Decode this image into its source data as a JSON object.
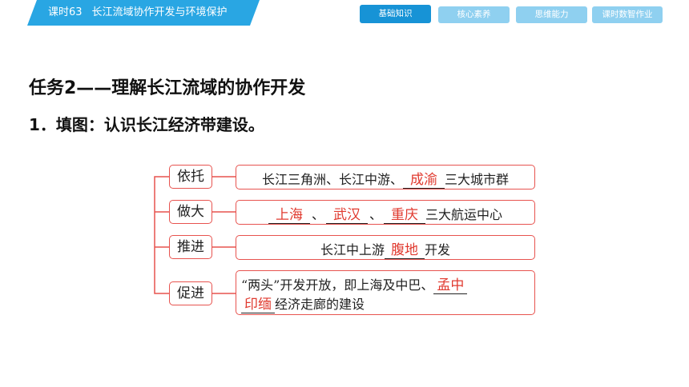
{
  "header": {
    "lesson_number": "课时63",
    "lesson_title": "长江流域协作开发与环境保护",
    "tabs": [
      "基础知识",
      "核心素养",
      "思维能力",
      "课时数智作业"
    ]
  },
  "content": {
    "task_title": "任务2——理解长江流域的协作开发",
    "question": "1．填图：认识长江经济带建设。"
  },
  "diagram": {
    "rows": [
      {
        "label": "依托",
        "before": "长江三角洲、长江中游、",
        "answer": "成渝",
        "after": "三大城市群"
      },
      {
        "label": "做大",
        "answer1": "上海",
        "sep1": "、",
        "answer2": "武汉",
        "sep2": "、",
        "answer3": "重庆",
        "after": "三大航运中心"
      },
      {
        "label": "推进",
        "before": "长江中上游",
        "answer": "腹地",
        "after": "开发"
      },
      {
        "label": "促进",
        "line1_before": "“两头”开发开放，即上海及中巴、",
        "answer_part1": "孟中",
        "answer_part2": "印缅",
        "line2_after": "经济走廊的建设"
      }
    ],
    "colors": {
      "border": "#e7534f",
      "answer": "#e03a2f"
    }
  }
}
